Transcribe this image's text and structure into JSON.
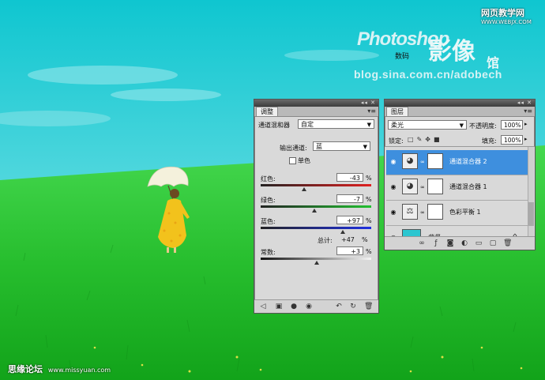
{
  "colors": {
    "sky_top": "#0fc6d0",
    "sky_bottom": "#4fd6dd",
    "grass_top": "#3ed34a",
    "grass_bottom": "#14a81c",
    "selection_blue": "#3e8fde"
  },
  "watermarks": {
    "top_right_site": "网页教学网",
    "top_right_url": "WWW.WEBJX.COM",
    "brand_photoshop": "Photoshop",
    "brand_shuma": "数码",
    "brand_yingxiang": "影像",
    "brand_guan": "馆",
    "blog_url": "blog.sina.com.cn/adobech",
    "bottom_left": "思缘论坛",
    "bottom_left_url": "www.missyuan.com"
  },
  "adjust_panel": {
    "tab_label": "调整",
    "preset_label": "通道混和器",
    "preset_value": "自定",
    "output_channel_label": "输出通道:",
    "output_channel_value": "蓝",
    "mono_label": "单色",
    "mono_checked": false,
    "red_label": "红色:",
    "red_value": "-43",
    "green_label": "绿色:",
    "green_value": "-7",
    "blue_label": "蓝色:",
    "blue_value": "+97",
    "total_label": "总计:",
    "total_value": "+47",
    "constant_label": "常数:",
    "constant_value": "+3",
    "percent": "%",
    "slider_levels": {
      "red": -43,
      "green": -7,
      "blue": 97,
      "constant": 3
    }
  },
  "layers_panel": {
    "tab_label": "图层",
    "blend_mode": "柔光",
    "opacity_label": "不透明度:",
    "opacity_value": "100%",
    "lock_label": "锁定:",
    "fill_label": "填充:",
    "fill_value": "100%",
    "layers": [
      {
        "name": "通道混合器 2",
        "selected": true,
        "icon": "channel-mixer-icon"
      },
      {
        "name": "通道混合器 1",
        "selected": false,
        "icon": "channel-mixer-icon"
      },
      {
        "name": "色彩平衡 1",
        "selected": false,
        "icon": "color-balance-icon"
      },
      {
        "name": "背景",
        "selected": false,
        "icon": "background-image"
      }
    ]
  }
}
